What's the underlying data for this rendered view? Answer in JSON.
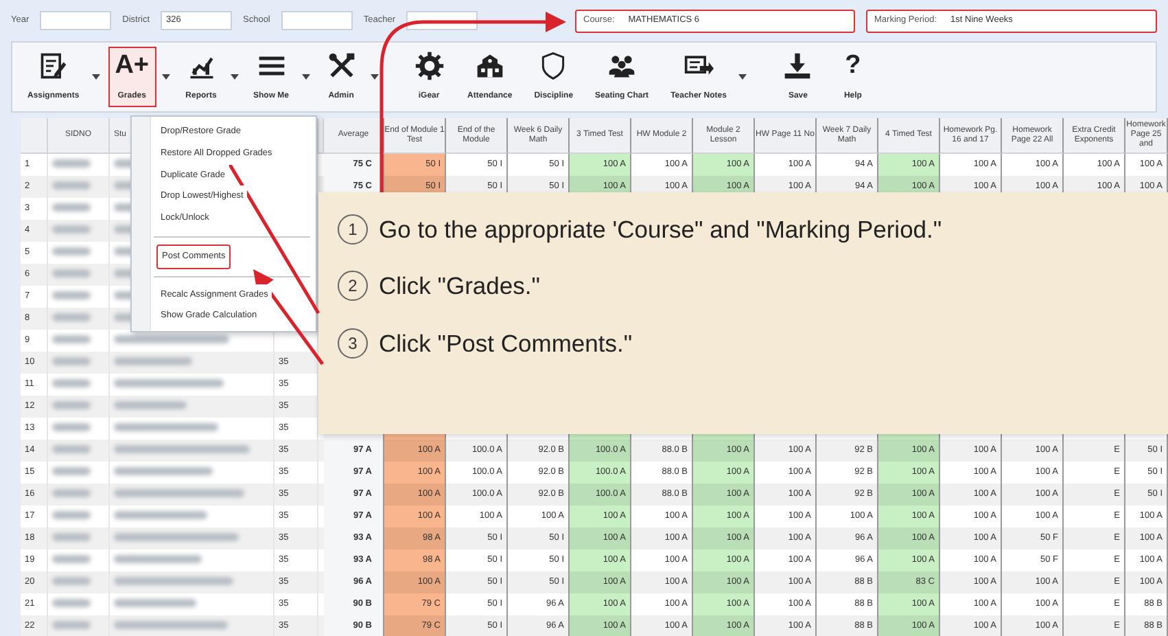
{
  "filters": [
    {
      "label": "Year"
    },
    {
      "label": "District",
      "value": "326"
    },
    {
      "label": "School"
    },
    {
      "label": "Teacher"
    }
  ],
  "course": {
    "label": "Course:",
    "value": "MATHEMATICS 6",
    "highlighted": true
  },
  "marking_period": {
    "label": "Marking Period:",
    "value": "1st Nine Weeks",
    "highlighted": true
  },
  "toolbar": [
    {
      "label": "Assignments",
      "has_menu": true,
      "selected": false
    },
    {
      "label": "Grades",
      "icon_text": "A+",
      "has_menu": true,
      "selected": true
    },
    {
      "label": "Reports",
      "has_menu": true,
      "selected": false
    },
    {
      "label": "Show Me",
      "has_menu": true,
      "selected": false
    },
    {
      "label": "Admin",
      "has_menu": true,
      "selected": false
    },
    {
      "label": "iGear",
      "has_menu": false,
      "selected": false
    },
    {
      "label": "Attendance",
      "has_menu": false,
      "selected": false
    },
    {
      "label": "Discipline",
      "has_menu": false,
      "selected": false
    },
    {
      "label": "Seating Chart",
      "has_menu": false,
      "selected": false
    },
    {
      "label": "Teacher Notes",
      "has_menu": true,
      "selected": false
    },
    {
      "label": "Save",
      "has_menu": false,
      "selected": false
    },
    {
      "label": "Help",
      "icon_text": "?",
      "has_menu": false,
      "selected": false
    }
  ],
  "table": {
    "left_columns": [
      "SIDNO",
      "Stu"
    ],
    "columns": [
      {
        "label": "Average"
      },
      {
        "label": "End of Module 1 Test",
        "color": "#f9b58c"
      },
      {
        "label": "End of the Module"
      },
      {
        "label": "Week 6 Daily Math"
      },
      {
        "label": "3 Timed Test",
        "color": "#c9efc4"
      },
      {
        "label": "HW Module 2"
      },
      {
        "label": "Module 2 Lesson",
        "color": "#c9efc4"
      },
      {
        "label": "HW Page 11 No"
      },
      {
        "label": "Week 7 Daily Math"
      },
      {
        "label": "4 Timed Test",
        "color": "#c9efc4"
      },
      {
        "label": "Homework Pg. 16 and 17"
      },
      {
        "label": "Homework Page 22 All"
      },
      {
        "label": "Extra Credit Exponents"
      },
      {
        "label": "Homework Page 25 and"
      }
    ],
    "rows": [
      {
        "number": "1",
        "grades": [
          "75 C",
          "50 I",
          "50 I",
          "50 I",
          "100 A",
          "100 A",
          "100 A",
          "100 A",
          "94 A",
          "100 A",
          "100 A",
          "100 A",
          "100 A",
          "100 A"
        ]
      },
      {
        "number": "2",
        "grades": [
          "75 C",
          "50 I",
          "50 I",
          "50 I",
          "100 A",
          "100 A",
          "100 A",
          "100 A",
          "94 A",
          "100 A",
          "100 A",
          "100 A",
          "100 A",
          "100 A"
        ]
      },
      {
        "number": "3"
      },
      {
        "number": "4"
      },
      {
        "number": "5"
      },
      {
        "number": "6"
      },
      {
        "number": "7"
      },
      {
        "number": "8"
      },
      {
        "number": "9"
      },
      {
        "number": "10",
        "grade_level": "35"
      },
      {
        "number": "11",
        "grade_level": "35"
      },
      {
        "number": "12",
        "grade_level": "35"
      },
      {
        "number": "13",
        "grade_level": "35"
      },
      {
        "number": "14",
        "grade_level": "35",
        "grades": [
          "97 A",
          "100 A",
          "100.0 A",
          "92.0 B",
          "100.0 A",
          "88.0 B",
          "100 A",
          "100 A",
          "92 B",
          "100 A",
          "100 A",
          "100 A",
          "E",
          "50 I"
        ]
      },
      {
        "number": "15",
        "grade_level": "35",
        "grades": [
          "97 A",
          "100 A",
          "100.0 A",
          "92.0 B",
          "100.0 A",
          "88.0 B",
          "100 A",
          "100 A",
          "92 B",
          "100 A",
          "100 A",
          "100 A",
          "E",
          "50 I"
        ]
      },
      {
        "number": "16",
        "grade_level": "35",
        "grades": [
          "97 A",
          "100 A",
          "100.0 A",
          "92.0 B",
          "100.0 A",
          "88.0 B",
          "100 A",
          "100 A",
          "92 B",
          "100 A",
          "100 A",
          "100 A",
          "E",
          "50 I"
        ]
      },
      {
        "number": "17",
        "grade_level": "35",
        "grades": [
          "97 A",
          "100 A",
          "100 A",
          "100 A",
          "100 A",
          "100 A",
          "100 A",
          "100 A",
          "100 A",
          "100 A",
          "100 A",
          "100 A",
          "E",
          "100 A"
        ]
      },
      {
        "number": "18",
        "grade_level": "35",
        "grades": [
          "93 A",
          "98 A",
          "50 I",
          "50 I",
          "100 A",
          "100 A",
          "100 A",
          "100 A",
          "96 A",
          "100 A",
          "100 A",
          "50 F",
          "E",
          "100 A"
        ]
      },
      {
        "number": "19",
        "grade_level": "35",
        "grades": [
          "93 A",
          "98 A",
          "50 I",
          "50 I",
          "100 A",
          "100 A",
          "100 A",
          "100 A",
          "96 A",
          "100 A",
          "100 A",
          "50 F",
          "E",
          "100 A"
        ]
      },
      {
        "number": "20",
        "grade_level": "35",
        "grades": [
          "96 A",
          "100 A",
          "50 I",
          "50 I",
          "100 A",
          "100 A",
          "100 A",
          "100 A",
          "88 B",
          "83 C",
          "100 A",
          "100 A",
          "E",
          "100 A"
        ]
      },
      {
        "number": "21",
        "grade_level": "35",
        "grades": [
          "90 B",
          "79 C",
          "50 I",
          "96 A",
          "100 A",
          "100 A",
          "100 A",
          "100 A",
          "88 B",
          "100 A",
          "100 A",
          "100 A",
          "E",
          "88 B"
        ]
      },
      {
        "number": "22",
        "grade_level": "35",
        "grades": [
          "90 B",
          "79 C",
          "50 I",
          "96 A",
          "100 A",
          "100 A",
          "100 A",
          "100 A",
          "88 B",
          "100 A",
          "100 A",
          "100 A",
          "E",
          "88 B"
        ]
      }
    ]
  },
  "grades_menu": {
    "groups": [
      [
        {
          "label": "Drop/Restore Grade",
          "highlighted": false
        },
        {
          "label": "Restore All Dropped Grades",
          "highlighted": false
        },
        {
          "label": "Duplicate Grade",
          "highlighted": false
        },
        {
          "label": "Drop Lowest/Highest",
          "highlighted": false
        },
        {
          "label": "Lock/Unlock",
          "highlighted": false
        }
      ],
      [
        {
          "label": "Post Comments",
          "highlighted": true
        }
      ],
      [
        {
          "label": "Recalc Assignment Grades",
          "highlighted": false
        },
        {
          "label": "Show Grade Calculation",
          "highlighted": false
        }
      ]
    ]
  },
  "callout": {
    "steps": [
      {
        "number": "1",
        "text": "Go to the appropriate 'Course\" and \"Marking Period.\""
      },
      {
        "number": "2",
        "text": "Click \"Grades.\""
      },
      {
        "number": "3",
        "text": "Click \"Post Comments.\""
      }
    ]
  }
}
